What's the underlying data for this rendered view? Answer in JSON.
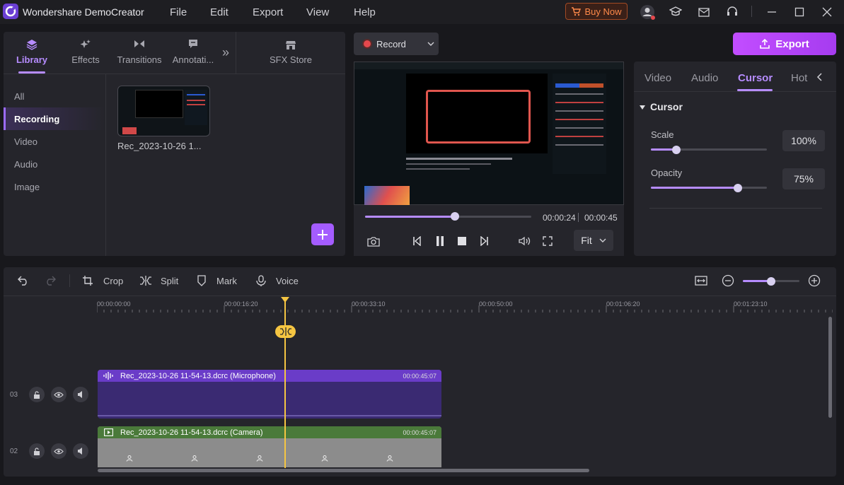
{
  "app": {
    "title": "Wondershare DemoCreator"
  },
  "menu": [
    "File",
    "Edit",
    "Export",
    "View",
    "Help"
  ],
  "buy_now": "Buy Now",
  "library": {
    "tabs": [
      {
        "label": "Library",
        "icon": "layers-icon"
      },
      {
        "label": "Effects",
        "icon": "sparkle-icon"
      },
      {
        "label": "Transitions",
        "icon": "bowtie-icon"
      },
      {
        "label": "Annotati...",
        "icon": "comment-icon"
      }
    ],
    "more": "»",
    "sfx_store": "SFX Store",
    "categories": [
      "All",
      "Recording",
      "Video",
      "Audio",
      "Image"
    ],
    "active_category": "Recording",
    "clip_name": "Rec_2023-10-26 1..."
  },
  "player": {
    "record_label": "Record",
    "current_time": "00:00:24",
    "total_time": "00:00:45",
    "progress": 0.5,
    "fit_label": "Fit"
  },
  "export_label": "Export",
  "properties": {
    "tabs": [
      "Video",
      "Audio",
      "Cursor",
      "Hot"
    ],
    "active_tab": "Cursor",
    "section": "Cursor",
    "scale_label": "Scale",
    "scale_value": "100%",
    "scale_level": 0.22,
    "opacity_label": "Opacity",
    "opacity_value": "75%",
    "opacity_level": 0.75
  },
  "timeline": {
    "tools": {
      "crop": "Crop",
      "split": "Split",
      "mark": "Mark",
      "voice": "Voice"
    },
    "ruler": [
      "00:00:00:00",
      "00:00:16:20",
      "00:00:33:10",
      "00:00:50:00",
      "00:01:06:20",
      "00:01:23:10"
    ],
    "tracks": [
      {
        "number": "03",
        "clip_name": "Rec_2023-10-26 11-54-13.dcrc (Microphone)",
        "duration": "00:00:45:07",
        "color": "#6a3cc8"
      },
      {
        "number": "02",
        "clip_name": "Rec_2023-10-26 11-54-13.dcrc (Camera)",
        "duration": "00:00:45:07",
        "color": "#4a7a3a"
      }
    ],
    "zoom_level": 0.5
  },
  "colors": {
    "accent": "#b68cff",
    "export": "#c24dff",
    "playhead": "#f5c542"
  }
}
